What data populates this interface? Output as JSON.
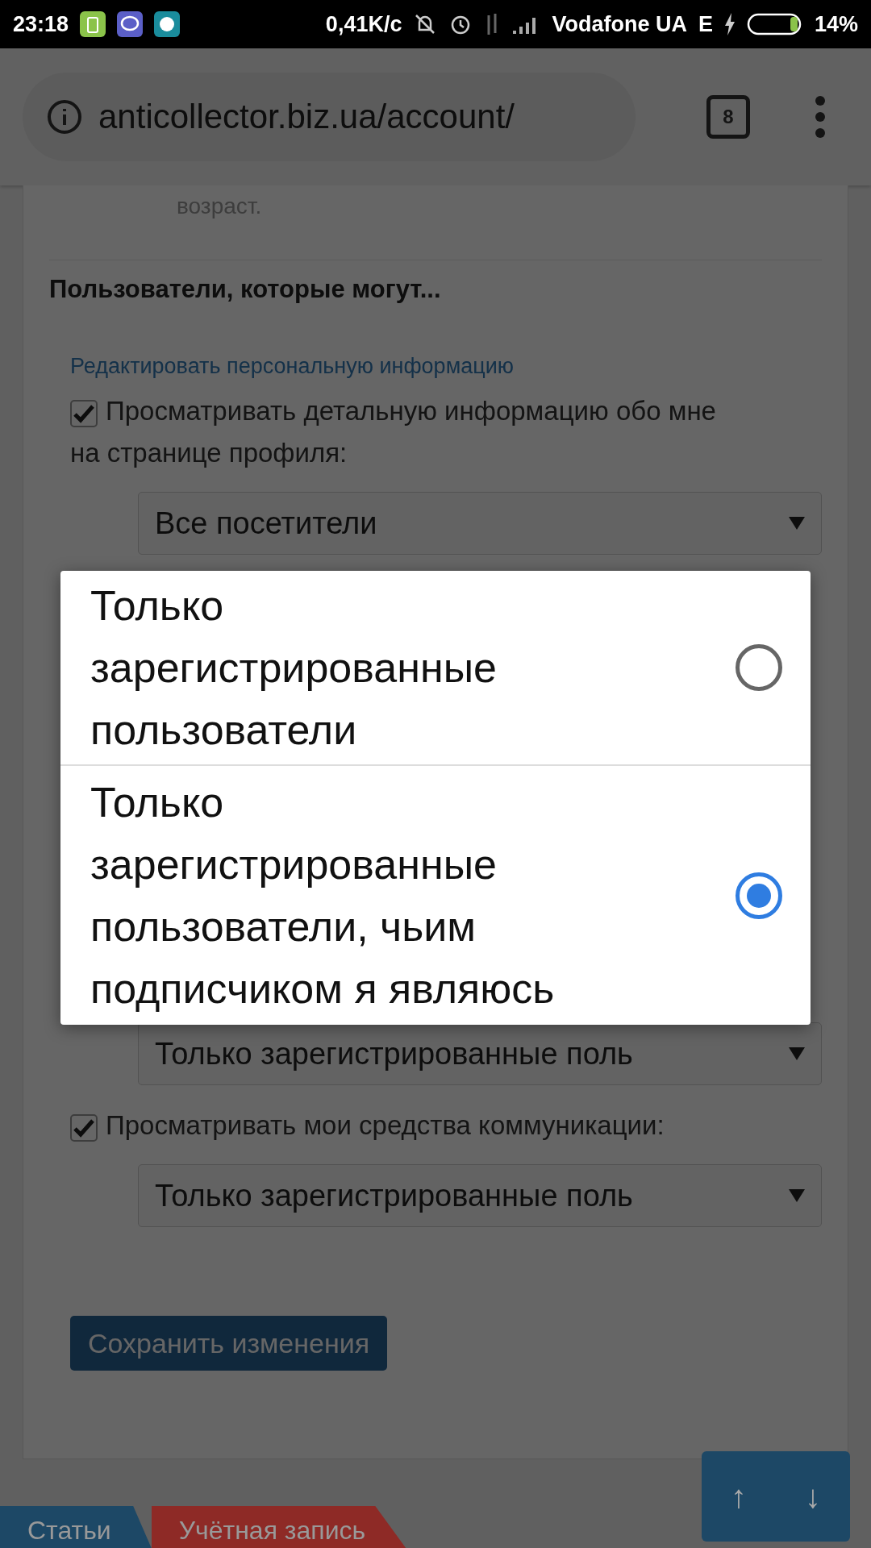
{
  "status_bar": {
    "time": "23:18",
    "speed": "0,41K/c",
    "carrier": "Vodafone UA",
    "network": "E",
    "battery": "14%"
  },
  "browser": {
    "url": "anticollector.biz.ua/account/",
    "tab_count": "8"
  },
  "page": {
    "fragment": "возраст.",
    "heading": "Пользователи, которые могут...",
    "link": "Редактировать персональную информацию",
    "first_option": {
      "label": "Просматривать детальную информацию обо мне на странице профиля:",
      "checked": true,
      "select": "Все посетители"
    },
    "partial_select": "Только зарегистрированные поль",
    "last_option": {
      "label": "Просматривать мои средства коммуникации:",
      "checked": true,
      "select": "Только зарегистрированные поль"
    },
    "save_button": "Сохранить изменения"
  },
  "scroll_buttons": [
    "↑",
    "↓"
  ],
  "bottom_tabs": [
    {
      "label": "Статьи",
      "color": "#1d4866"
    },
    {
      "label": "Учётная запись",
      "color": "#8e2a26"
    }
  ],
  "dialog": {
    "options": [
      {
        "label": "Только зарегистрированные пользователи",
        "selected": false
      },
      {
        "label": "Только зарегистрированные пользователи, чьим подписчиком я являюсь",
        "selected": true
      }
    ]
  }
}
